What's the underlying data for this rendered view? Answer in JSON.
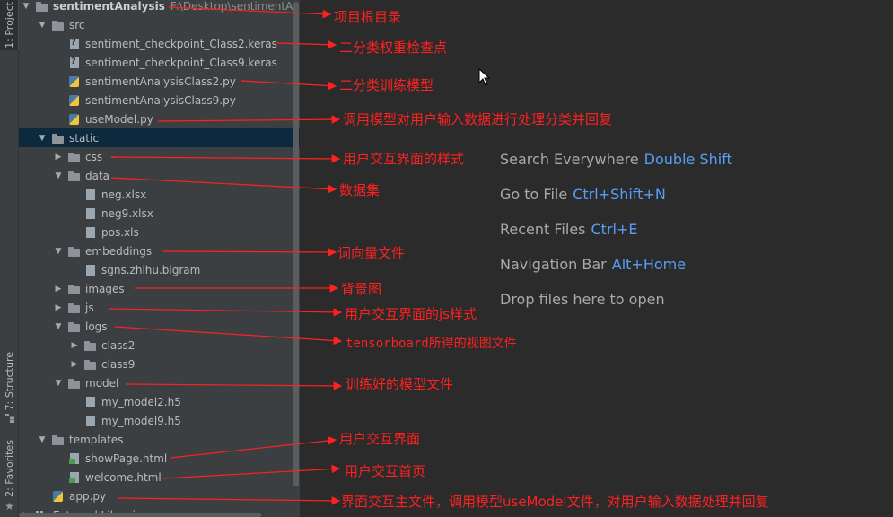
{
  "tool_window_tabs": {
    "project": "1: Project",
    "structure": "7: Structure",
    "favorites": "2: Favorites"
  },
  "tree": {
    "root": {
      "label": "sentimentAnalysis",
      "path": "F:\\Desktop\\sentimentAnaly"
    },
    "src": "src",
    "src_files": [
      "sentiment_checkpoint_Class2.keras",
      "sentiment_checkpoint_Class9.keras",
      "sentimentAnalysisClass2.py",
      "sentimentAnalysisClass9.py",
      "useModel.py"
    ],
    "static": "static",
    "css": "css",
    "data": "data",
    "data_files": [
      "neg.xlsx",
      "neg9.xlsx",
      "pos.xls"
    ],
    "embeddings": "embeddings",
    "embeddings_files": [
      "sgns.zhihu.bigram"
    ],
    "images": "images",
    "js": "js",
    "logs": "logs",
    "logs_children": [
      "class2",
      "class9"
    ],
    "model": "model",
    "model_files": [
      "my_model2.h5",
      "my_model9.h5"
    ],
    "templates": "templates",
    "template_files": [
      "showPage.html",
      "welcome.html"
    ],
    "app": "app.py",
    "external": "External Libraries"
  },
  "editor_hints": [
    {
      "label": "Search Everywhere",
      "key": "Double Shift"
    },
    {
      "label": "Go to File",
      "key": "Ctrl+Shift+N"
    },
    {
      "label": "Recent Files",
      "key": "Ctrl+E"
    },
    {
      "label": "Navigation Bar",
      "key": "Alt+Home"
    },
    {
      "label": "Drop files here to open",
      "key": ""
    }
  ],
  "annotations": [
    "项目根目录",
    "二分类权重检查点",
    "二分类训练模型",
    "调用模型对用户输入数据进行处理分类并回复",
    "用户交互界面的样式",
    "数据集",
    "词向量文件",
    "背景图",
    "用户交互界面的js样式",
    "tensorboard所得的视图文件",
    "训练好的模型文件",
    "用户交互界面",
    "用户交互首页",
    "界面交互主文件，调用模型useModel文件，对用户输入数据处理并回复"
  ],
  "colors": {
    "annotation": "#ff2020",
    "hint_key": "#589df6",
    "panel_bg": "#3c3f41",
    "editor_bg": "#2b2b2b",
    "selection": "#0d293e"
  }
}
